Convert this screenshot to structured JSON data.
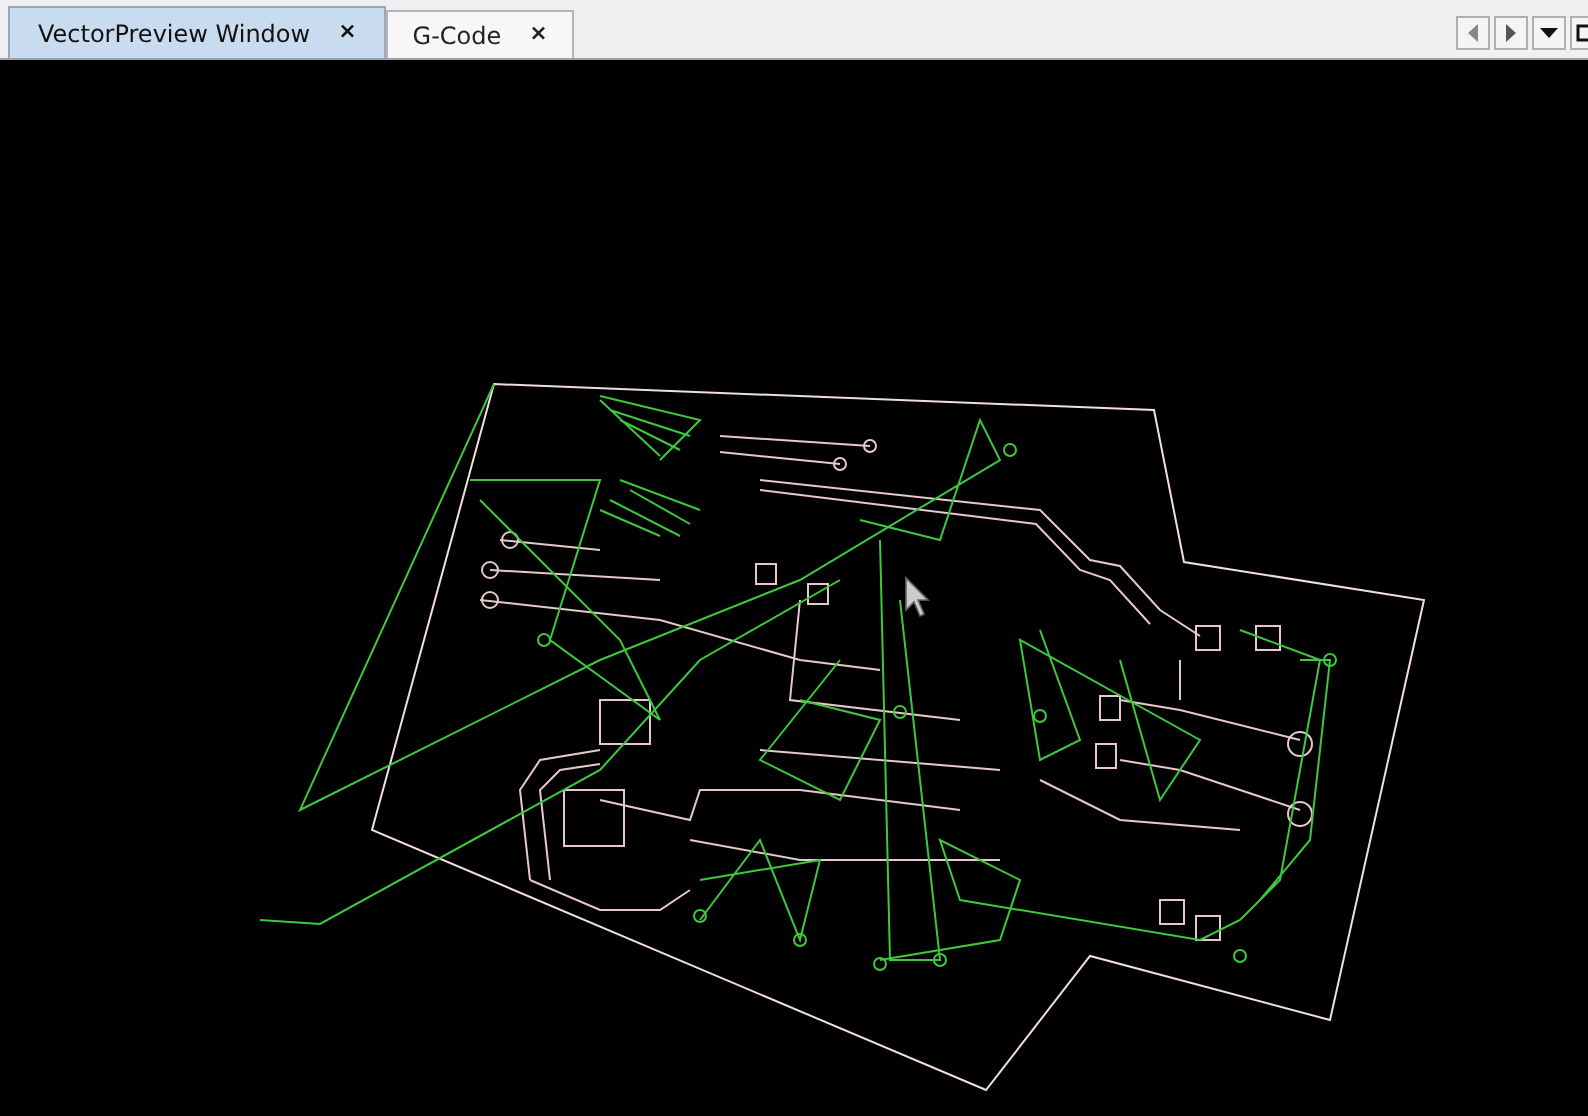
{
  "tabs": [
    {
      "label": "VectorPreview Window",
      "close": "×",
      "selected": true
    },
    {
      "label": "G-Code",
      "close": "×",
      "selected": false
    }
  ]
}
